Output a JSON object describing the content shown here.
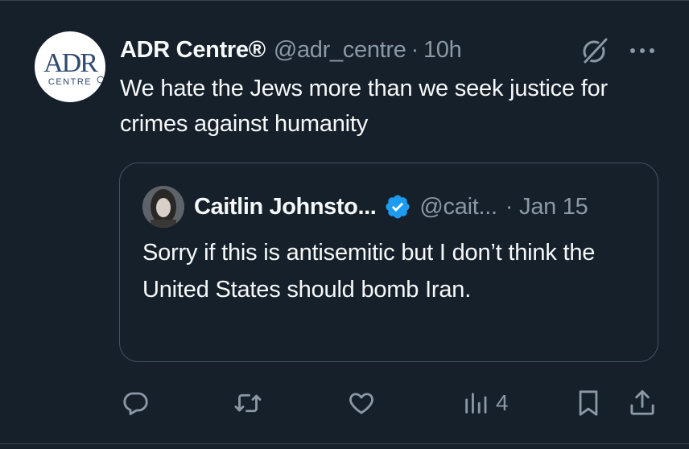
{
  "tweet": {
    "avatar": {
      "logo_text": "ADR",
      "logo_subtext": "CENTRE",
      "icon": "adr-centre-logo"
    },
    "display_name": "ADR Centre®",
    "handle": "@adr_centre",
    "separator": "·",
    "time": "10h",
    "text": "We hate the Jews more than we seek justice for crimes against humanity",
    "header_icons": [
      "grok-icon",
      "more-icon"
    ],
    "quoted": {
      "display_name": "Caitlin Johnsto...",
      "verified": true,
      "verified_color": "#1d9bf0",
      "handle": "@cait...",
      "separator": "·",
      "time": "Jan 15",
      "text": "Sorry if this is antisemitic but I don’t think the United States should bomb Iran."
    },
    "actions": {
      "reply_icon": "reply-icon",
      "retweet_icon": "retweet-icon",
      "like_icon": "like-icon",
      "views_icon": "views-icon",
      "views_count": "4",
      "bookmark_icon": "bookmark-icon",
      "share_icon": "share-icon"
    }
  },
  "colors": {
    "background": "#15202b",
    "text_primary": "#f7f9f9",
    "text_secondary": "#8b98a5",
    "border": "#425360",
    "verified": "#1d9bf0"
  }
}
